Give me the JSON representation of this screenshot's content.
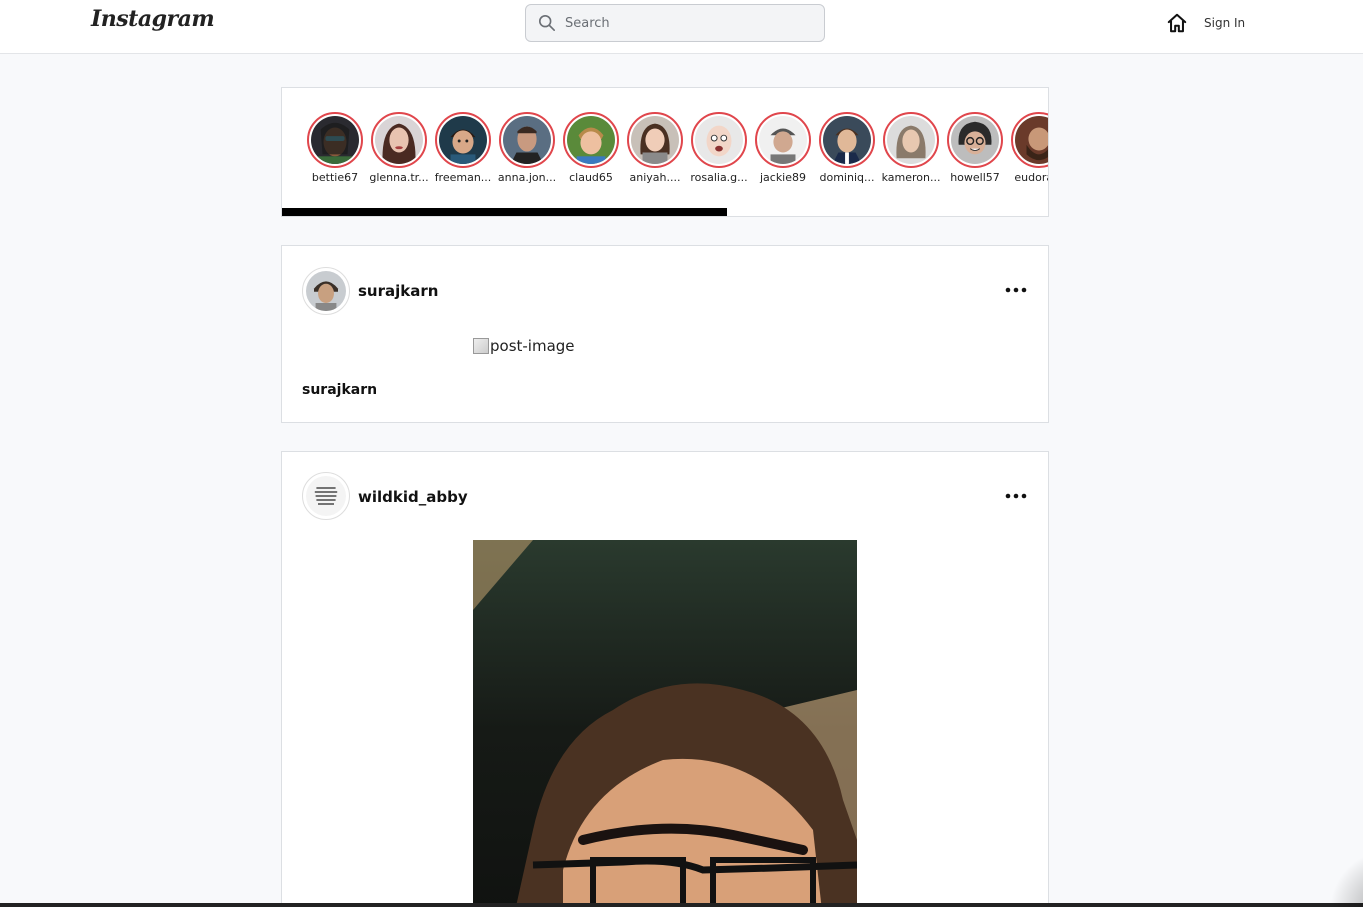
{
  "header": {
    "logo": "Instagram",
    "search_placeholder": "Search",
    "sign_in": "Sign In",
    "icons": [
      "search-icon",
      "home-icon"
    ]
  },
  "stories": [
    {
      "username": "bettie67"
    },
    {
      "username": "glenna.tr..."
    },
    {
      "username": "freeman..."
    },
    {
      "username": "anna.jon..."
    },
    {
      "username": "claud65"
    },
    {
      "username": "aniyah...."
    },
    {
      "username": "rosalia.g..."
    },
    {
      "username": "jackie89"
    },
    {
      "username": "dominiq..."
    },
    {
      "username": "kameron..."
    },
    {
      "username": "howell57"
    },
    {
      "username": "eudora..."
    }
  ],
  "colors": {
    "story_ring": "#e0464c",
    "background": "#f8f9fb",
    "card": "#ffffff"
  },
  "posts": [
    {
      "username": "surajkarn",
      "image_alt": "post-image",
      "caption_user": "surajkarn"
    },
    {
      "username": "wildkid_abby"
    }
  ]
}
